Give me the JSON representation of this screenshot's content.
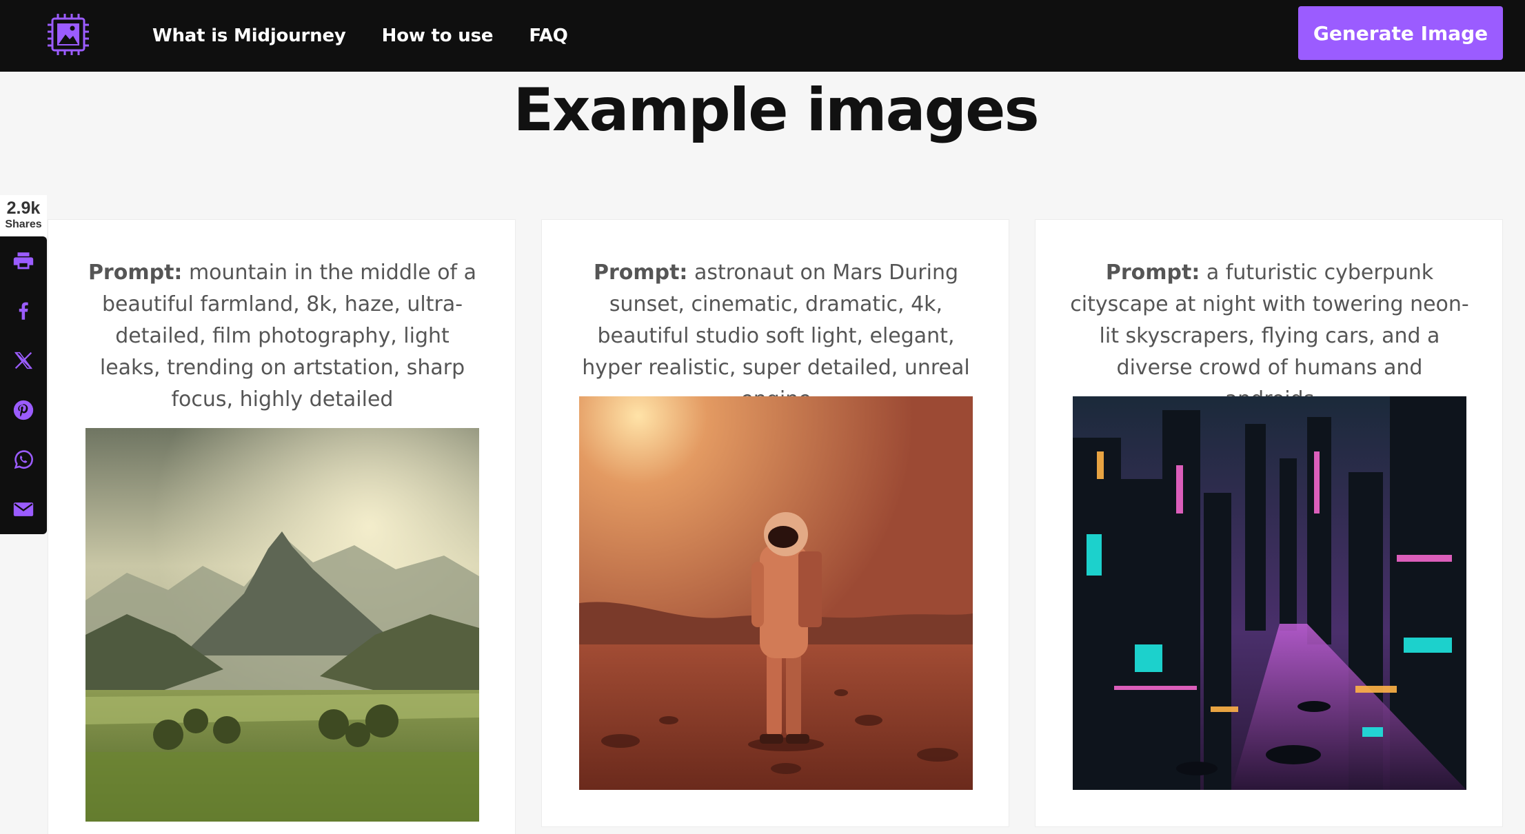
{
  "header": {
    "nav": [
      "What is Midjourney",
      "How to use",
      "FAQ"
    ],
    "cta_label": "Generate Image"
  },
  "page_title": "Example images",
  "share": {
    "count": "2.9k",
    "label": "Shares",
    "icons": [
      "print-icon",
      "facebook-icon",
      "x-icon",
      "pinterest-icon",
      "whatsapp-icon",
      "email-icon"
    ]
  },
  "cards": [
    {
      "prompt_label": "Prompt:",
      "prompt_text": " mountain in the middle of a beautiful farmland, 8k, haze, ultra-detailed, film photography, light leaks, trending on artstation, sharp focus, highly detailed"
    },
    {
      "prompt_label": "Prompt:",
      "prompt_text": " astronaut on Mars During sunset, cinematic, dramatic, 4k, beautiful studio soft light, elegant, hyper realistic, super detailed, unreal engine"
    },
    {
      "prompt_label": "Prompt:",
      "prompt_text": " a futuristic cyberpunk cityscape at night with towering neon-lit skyscrapers, flying cars, and a diverse crowd of humans and androids"
    }
  ],
  "colors": {
    "accent": "#9b5cff",
    "header_bg": "#0f0f0f",
    "page_bg": "#f6f6f6"
  }
}
